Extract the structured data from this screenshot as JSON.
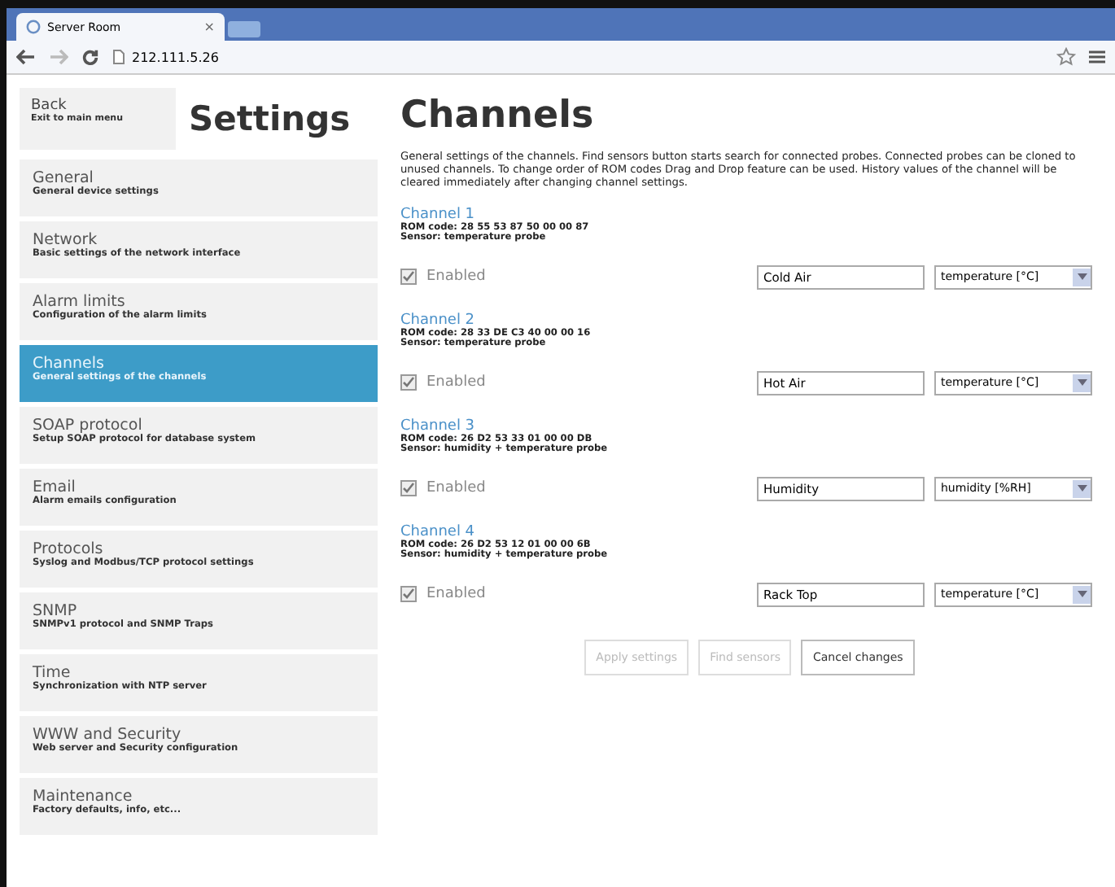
{
  "browser": {
    "tab_title": "Server Room",
    "tab_close": "×",
    "address": "212.111.5.26"
  },
  "sidebar": {
    "back": {
      "title": "Back",
      "subtitle": "Exit to main menu"
    },
    "heading": "Settings",
    "items": [
      {
        "title": "General",
        "subtitle": "General device settings",
        "selected": false
      },
      {
        "title": "Network",
        "subtitle": "Basic settings of the network interface",
        "selected": false
      },
      {
        "title": "Alarm limits",
        "subtitle": "Configuration of the alarm limits",
        "selected": false
      },
      {
        "title": "Channels",
        "subtitle": "General settings of the channels",
        "selected": true
      },
      {
        "title": "SOAP protocol",
        "subtitle": "Setup SOAP protocol for database system",
        "selected": false
      },
      {
        "title": "Email",
        "subtitle": "Alarm emails configuration",
        "selected": false
      },
      {
        "title": "Protocols",
        "subtitle": "Syslog and Modbus/TCP protocol settings",
        "selected": false
      },
      {
        "title": "SNMP",
        "subtitle": "SNMPv1 protocol and SNMP Traps",
        "selected": false
      },
      {
        "title": "Time",
        "subtitle": "Synchronization with NTP server",
        "selected": false
      },
      {
        "title": "WWW and Security",
        "subtitle": "Web server and Security configuration",
        "selected": false
      },
      {
        "title": "Maintenance",
        "subtitle": "Factory defaults, info, etc...",
        "selected": false
      }
    ]
  },
  "main": {
    "heading": "Channels",
    "description": "General settings of the channels. Find sensors button starts search for connected probes. Connected probes can be cloned to unused channels. To change order of ROM codes Drag and Drop feature can be used. History values of the channel will be cleared immediately after changing channel settings.",
    "channels": [
      {
        "title": "Channel 1",
        "rom": "ROM code: 28 55 53 87 50 00 00 87",
        "sensor": "Sensor: temperature probe",
        "enabled_label": "Enabled",
        "checked": true,
        "disabled": true,
        "name": "Cold Air",
        "unit": "temperature [°C]"
      },
      {
        "title": "Channel 2",
        "rom": "ROM code: 28 33 DE C3 40 00 00 16",
        "sensor": "Sensor: temperature probe",
        "enabled_label": "Enabled",
        "checked": true,
        "disabled": true,
        "name": "Hot Air",
        "unit": "temperature [°C]"
      },
      {
        "title": "Channel 3",
        "rom": "ROM code: 26 D2 53 33 01 00 00 DB",
        "sensor": "Sensor: humidity + temperature probe",
        "enabled_label": "Enabled",
        "checked": true,
        "disabled": true,
        "name": "Humidity",
        "unit": "humidity [%RH]"
      },
      {
        "title": "Channel 4",
        "rom": "ROM code: 26 D2 53 12 01 00 00 6B",
        "sensor": "Sensor: humidity + temperature probe",
        "enabled_label": "Enabled",
        "checked": true,
        "disabled": true,
        "name": "Rack Top",
        "unit": "temperature [°C]"
      }
    ],
    "buttons": [
      {
        "label": "Apply settings",
        "disabled": true
      },
      {
        "label": "Find sensors",
        "disabled": true
      },
      {
        "label": "Cancel changes",
        "disabled": false
      }
    ]
  }
}
